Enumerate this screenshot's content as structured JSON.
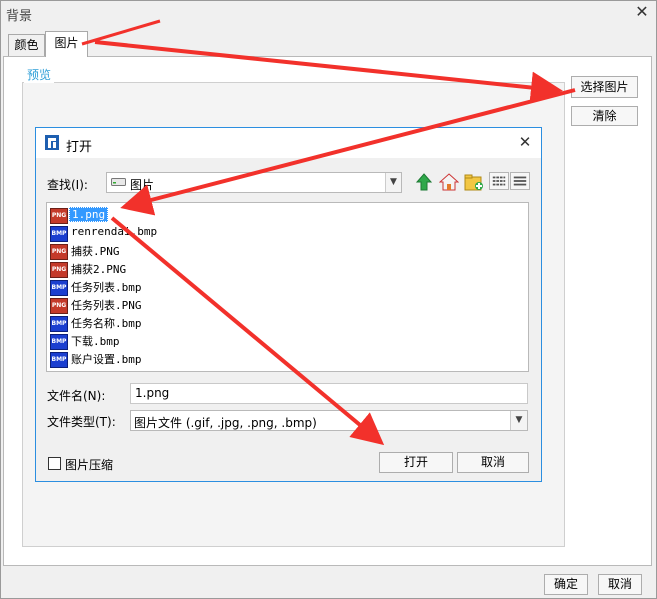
{
  "outer_dialog": {
    "title": "背景",
    "close_glyph": "✕",
    "tabs": [
      "颜色",
      "图片"
    ],
    "preview_label": "预览",
    "choose_image_button": "选择图片",
    "clear_button": "清除",
    "ok_button": "确定",
    "cancel_button": "取消"
  },
  "open_dialog": {
    "title": "打开",
    "close_glyph": "✕",
    "look_in_label": "查找(I):",
    "look_in_value": "图片",
    "combo_arrow": "▼",
    "toolbar_icons": [
      "up-folder-icon",
      "home-icon",
      "new-folder-icon",
      "list-view-icon",
      "details-view-icon"
    ],
    "files": [
      {
        "name": "1.png",
        "type": "PNG",
        "selected": true
      },
      {
        "name": "renrendai.bmp",
        "type": "BMP",
        "selected": false
      },
      {
        "name": "捕获.PNG",
        "type": "PNG",
        "selected": false
      },
      {
        "name": "捕获2.PNG",
        "type": "PNG",
        "selected": false
      },
      {
        "name": "任务列表.bmp",
        "type": "BMP",
        "selected": false
      },
      {
        "name": "任务列表.PNG",
        "type": "PNG",
        "selected": false
      },
      {
        "name": "任务名称.bmp",
        "type": "BMP",
        "selected": false
      },
      {
        "name": "下载.bmp",
        "type": "BMP",
        "selected": false
      },
      {
        "name": "账户设置.bmp",
        "type": "BMP",
        "selected": false
      }
    ],
    "file_name_label": "文件名(N):",
    "file_name_value": "1.png",
    "file_type_label": "文件类型(T):",
    "file_type_value": "图片文件 (.gif, .jpg, .png, .bmp)",
    "compress_label": "图片压缩",
    "compress_checked": false,
    "open_button": "打开",
    "cancel_button": "取消"
  },
  "annotation_color": "#f2312b",
  "accent_color": "#2f9fd8"
}
